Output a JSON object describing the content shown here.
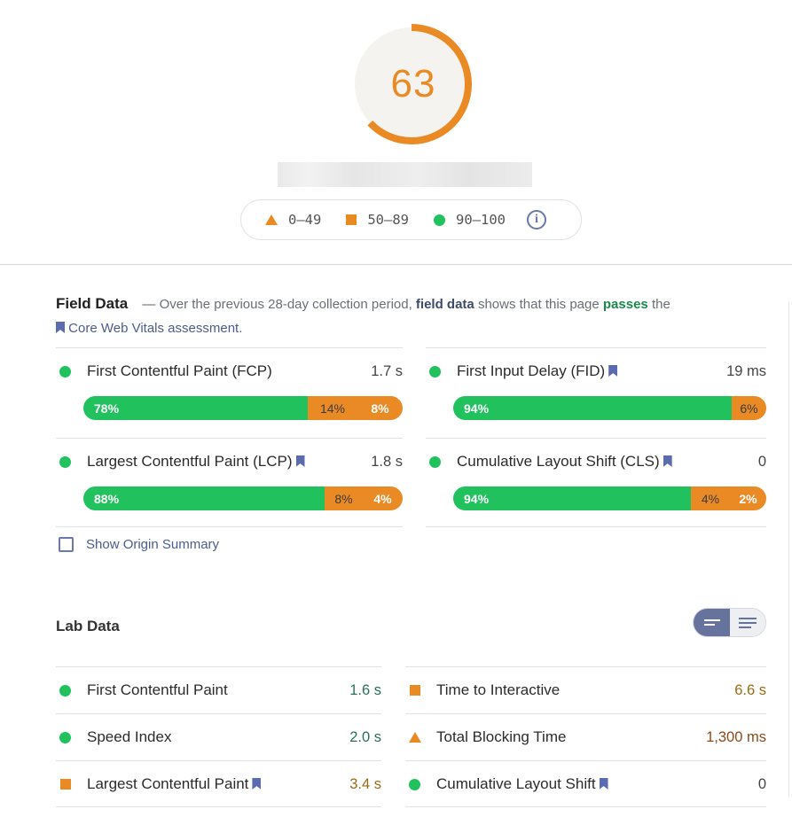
{
  "score": {
    "value": "63",
    "fraction": 0.63,
    "color": "#ea8a25",
    "track_color": "#f5f3ef"
  },
  "legend": {
    "ranges": [
      {
        "icon": "triangle-icon",
        "label": "0–49",
        "color": "#ea8a25"
      },
      {
        "icon": "square-icon",
        "label": "50–89",
        "color": "#ea8a25"
      },
      {
        "icon": "circle-icon",
        "label": "90–100",
        "color": "#21c15e"
      }
    ],
    "info_icon": "info-icon"
  },
  "field_data": {
    "title": "Field Data",
    "dash": "—",
    "desc_1": "Over the previous 28-day collection period,",
    "desc_strong": "field data",
    "desc_2": "shows that this page",
    "passes": "passes",
    "desc_3": "the",
    "cwv_link": "Core Web Vitals assessment.",
    "metrics": [
      {
        "name": "First Contentful Paint (FCP)",
        "value": "1.7 s",
        "good": "78%",
        "avg": "14%",
        "poor": "8%",
        "bookmark": false
      },
      {
        "name": "First Input Delay (FID)",
        "value": "19 ms",
        "good": "94%",
        "avg": "",
        "poor": "6%",
        "bookmark": true
      },
      {
        "name": "Largest Contentful Paint (LCP)",
        "value": "1.8 s",
        "good": "88%",
        "avg": "8%",
        "poor": "4%",
        "bookmark": true
      },
      {
        "name": "Cumulative Layout Shift (CLS)",
        "value": "0",
        "good": "94%",
        "avg": "4%",
        "poor": "2%",
        "bookmark": true
      }
    ],
    "origin_label": "Show Origin Summary"
  },
  "lab_data": {
    "title": "Lab Data",
    "rows": [
      {
        "name": "First Contentful Paint",
        "value": "1.6 s",
        "status": "good",
        "bookmark": false
      },
      {
        "name": "Time to Interactive",
        "value": "6.6 s",
        "status": "average",
        "bookmark": false
      },
      {
        "name": "Speed Index",
        "value": "2.0 s",
        "status": "good",
        "bookmark": false
      },
      {
        "name": "Total Blocking Time",
        "value": "1,300 ms",
        "status": "poor",
        "bookmark": false
      },
      {
        "name": "Largest Contentful Paint",
        "value": "3.4 s",
        "status": "average",
        "bookmark": true
      },
      {
        "name": "Cumulative Layout Shift",
        "value": "0",
        "status": "good",
        "bookmark": true
      }
    ]
  },
  "colors": {
    "good": "#21c15e",
    "average": "#ea8a25",
    "poor": "#ea8a25",
    "accent": "#66739c"
  }
}
